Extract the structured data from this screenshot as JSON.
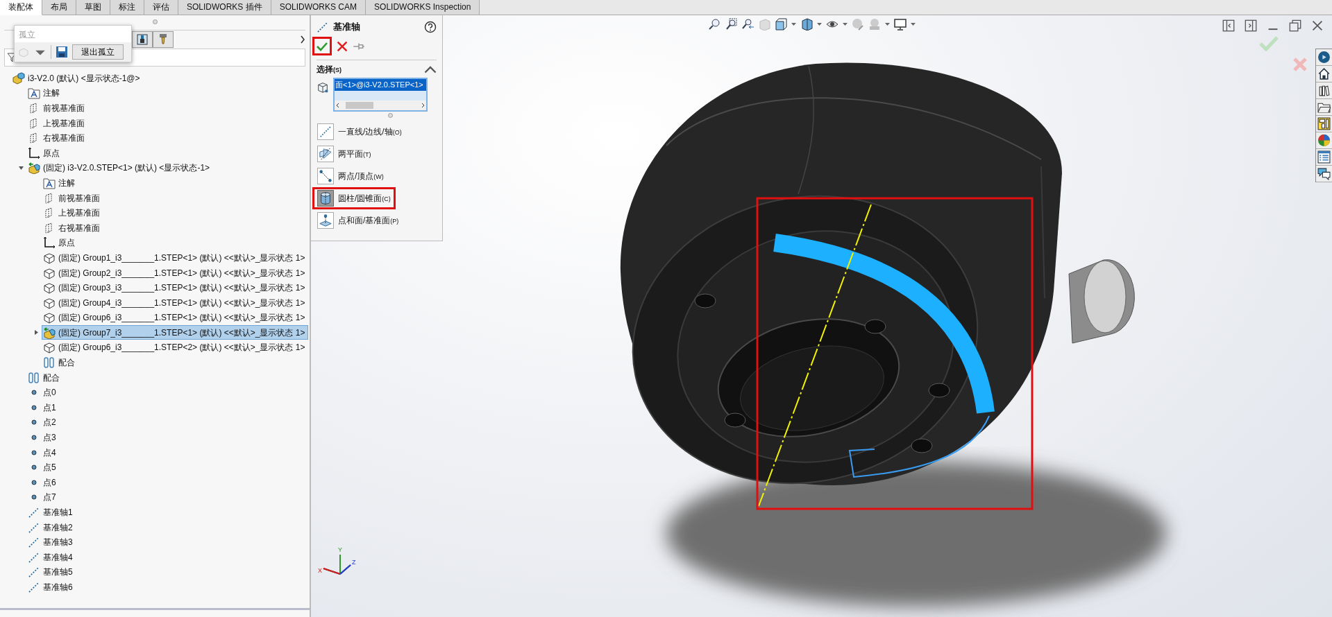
{
  "ribbon_tabs": [
    {
      "label": "装配体",
      "selected": true
    },
    {
      "label": "布局",
      "selected": false
    },
    {
      "label": "草图",
      "selected": false
    },
    {
      "label": "标注",
      "selected": false
    },
    {
      "label": "评估",
      "selected": false
    },
    {
      "label": "SOLIDWORKS 插件",
      "selected": false
    },
    {
      "label": "SOLIDWORKS CAM",
      "selected": false
    },
    {
      "label": "SOLIDWORKS Inspection",
      "selected": false
    }
  ],
  "isolate_popup": {
    "title": "孤立",
    "exit_button": "退出孤立"
  },
  "feature_tree": {
    "items": [
      {
        "kind": "assembly",
        "label": "i3-V2.0 (默认) <显示状态-1@>",
        "selected": false,
        "children": [
          {
            "kind": "annotation",
            "label": "注解",
            "selected": false
          },
          {
            "kind": "plane",
            "label": "前视基准面",
            "selected": false
          },
          {
            "kind": "plane",
            "label": "上视基准面",
            "selected": false
          },
          {
            "kind": "plane",
            "label": "右视基准面",
            "selected": false
          },
          {
            "kind": "origin",
            "label": "原点",
            "selected": false
          },
          {
            "kind": "part",
            "label": "(固定) i3-V2.0.STEP<1> (默认) <显示状态-1>",
            "selected": false,
            "expanded": true,
            "children": [
              {
                "kind": "annotation",
                "label": "注解",
                "selected": false
              },
              {
                "kind": "plane",
                "label": "前视基准面",
                "selected": false
              },
              {
                "kind": "plane",
                "label": "上视基准面",
                "selected": false
              },
              {
                "kind": "plane",
                "label": "右视基准面",
                "selected": false
              },
              {
                "kind": "origin",
                "label": "原点",
                "selected": false
              },
              {
                "kind": "group",
                "label": "(固定) Group1_i3_______1.STEP<1> (默认) <<默认>_显示状态 1>",
                "selected": false
              },
              {
                "kind": "group",
                "label": "(固定) Group2_i3_______1.STEP<1> (默认) <<默认>_显示状态 1>",
                "selected": false
              },
              {
                "kind": "group",
                "label": "(固定) Group3_i3_______1.STEP<1> (默认) <<默认>_显示状态 1>",
                "selected": false
              },
              {
                "kind": "group",
                "label": "(固定) Group4_i3_______1.STEP<1> (默认) <<默认>_显示状态 1>",
                "selected": false
              },
              {
                "kind": "group",
                "label": "(固定) Group6_i3_______1.STEP<1> (默认) <<默认>_显示状态 1>",
                "selected": false
              },
              {
                "kind": "part",
                "label": "(固定) Group7_i3_______1.STEP<1> (默认) <<默认>_显示状态 1>",
                "selected": true,
                "expanded": false
              },
              {
                "kind": "group",
                "label": "(固定) Group6_i3_______1.STEP<2> (默认) <<默认>_显示状态 1>",
                "selected": false
              },
              {
                "kind": "mate",
                "label": "配合",
                "selected": false
              }
            ]
          },
          {
            "kind": "mate",
            "label": "配合",
            "selected": false
          },
          {
            "kind": "point",
            "label": "点0",
            "selected": false
          },
          {
            "kind": "point",
            "label": "点1",
            "selected": false
          },
          {
            "kind": "point",
            "label": "点2",
            "selected": false
          },
          {
            "kind": "point",
            "label": "点3",
            "selected": false
          },
          {
            "kind": "point",
            "label": "点4",
            "selected": false
          },
          {
            "kind": "point",
            "label": "点5",
            "selected": false
          },
          {
            "kind": "point",
            "label": "点6",
            "selected": false
          },
          {
            "kind": "point",
            "label": "点7",
            "selected": false
          },
          {
            "kind": "axis",
            "label": "基准轴1",
            "selected": false
          },
          {
            "kind": "axis",
            "label": "基准轴2",
            "selected": false
          },
          {
            "kind": "axis",
            "label": "基准轴3",
            "selected": false
          },
          {
            "kind": "axis",
            "label": "基准轴4",
            "selected": false
          },
          {
            "kind": "axis",
            "label": "基准轴5",
            "selected": false
          },
          {
            "kind": "axis",
            "label": "基准轴6",
            "selected": false
          }
        ]
      }
    ]
  },
  "property_manager": {
    "title": "基准轴",
    "ok_highlighted": true,
    "section": "选择",
    "section_shortcut": "(S)",
    "selection": "面<1>@i3-V2.0.STEP<1>",
    "options": [
      {
        "kind": "line",
        "label": "一直线/边线/轴",
        "shortcut": "(O)",
        "selected": false,
        "highlighted": false
      },
      {
        "kind": "two-planes",
        "label": "两平面",
        "shortcut": "(T)",
        "selected": false,
        "highlighted": false
      },
      {
        "kind": "two-points",
        "label": "两点/顶点",
        "shortcut": "(W)",
        "selected": false,
        "highlighted": false
      },
      {
        "kind": "cylinder",
        "label": "圆柱/圆锥面",
        "shortcut": "(C)",
        "selected": true,
        "highlighted": true
      },
      {
        "kind": "point-plane",
        "label": "点和面/基准面",
        "shortcut": "(P)",
        "selected": false,
        "highlighted": false
      }
    ]
  },
  "viewport": {
    "highlight_frame": true,
    "triad": {
      "x": "X",
      "y": "Y",
      "z": "Z"
    }
  }
}
